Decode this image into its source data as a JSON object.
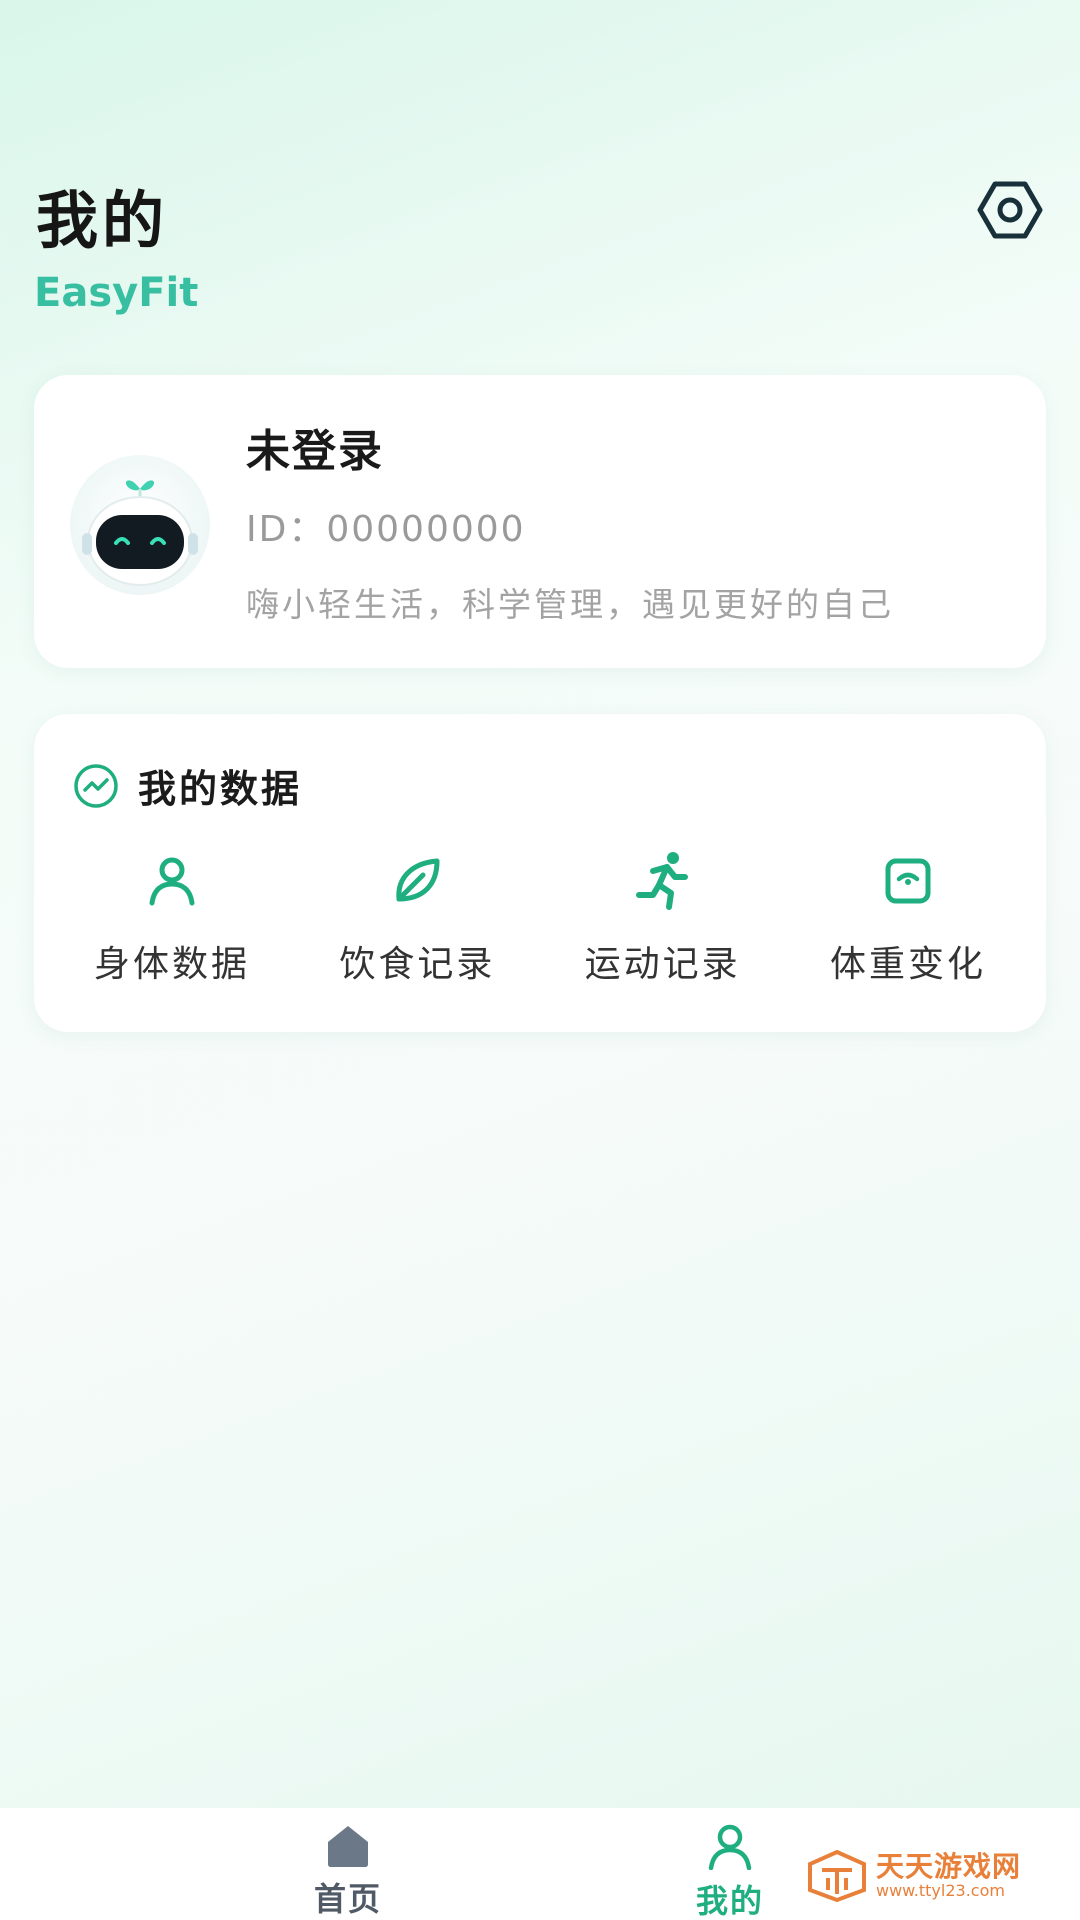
{
  "header": {
    "title": "我的",
    "subtitle": "EasyFit",
    "settings_icon": "gear-hexagon-icon"
  },
  "profile": {
    "username": "未登录",
    "id_text": "ID：00000000",
    "slogan": "嗨小轻生活，科学管理，遇见更好的自己",
    "avatar_icon": "robot-avatar"
  },
  "my_data": {
    "title": "我的数据",
    "title_icon": "trend-chart-icon",
    "items": [
      {
        "label": "身体数据",
        "icon": "person-icon"
      },
      {
        "label": "饮食记录",
        "icon": "leaf-icon"
      },
      {
        "label": "运动记录",
        "icon": "runner-icon"
      },
      {
        "label": "体重变化",
        "icon": "scale-icon"
      }
    ]
  },
  "tabbar": {
    "tabs": [
      {
        "label": "首页",
        "icon": "home-icon",
        "active": false
      },
      {
        "label": "我的",
        "icon": "user-icon",
        "active": true
      }
    ]
  },
  "watermark": {
    "name": "天天游戏网",
    "url": "www.ttyl23.com"
  },
  "colors": {
    "accent": "#1fae7f",
    "subtitle": "#38bfa2",
    "watermark": "#e8803a"
  }
}
